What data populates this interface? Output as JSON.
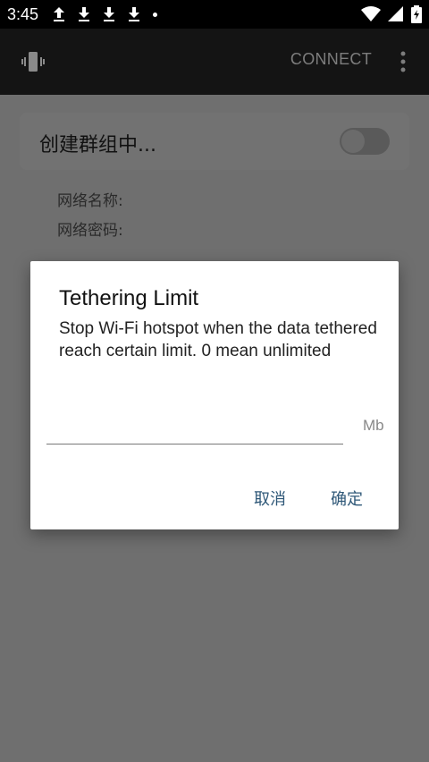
{
  "status_bar": {
    "time": "3:45",
    "icons_left": [
      "upload-icon",
      "download-icon",
      "download-icon",
      "download-icon",
      "notification-dot"
    ],
    "icons_right": [
      "wifi-icon",
      "signal-icon",
      "battery-charging-icon"
    ]
  },
  "app_bar": {
    "app_icon": "phone-vibrate-icon",
    "connect_label": "CONNECT",
    "overflow_icon": "more-vert-icon"
  },
  "background_content": {
    "group_label": "创建群组中...",
    "toggle_state": "off",
    "network_name_label": "网络名称:",
    "network_password_label": "网络密码:"
  },
  "dialog": {
    "title": "Tethering Limit",
    "message": "Stop Wi-Fi hotspot when the data tethered reach certain limit. 0 mean unlimited",
    "input_value": "",
    "unit": "Mb",
    "cancel_label": "取消",
    "ok_label": "确定"
  },
  "colors": {
    "overlay": "#6f6f6f",
    "appbar": "#141414",
    "dialog_button": "#2f5878"
  }
}
